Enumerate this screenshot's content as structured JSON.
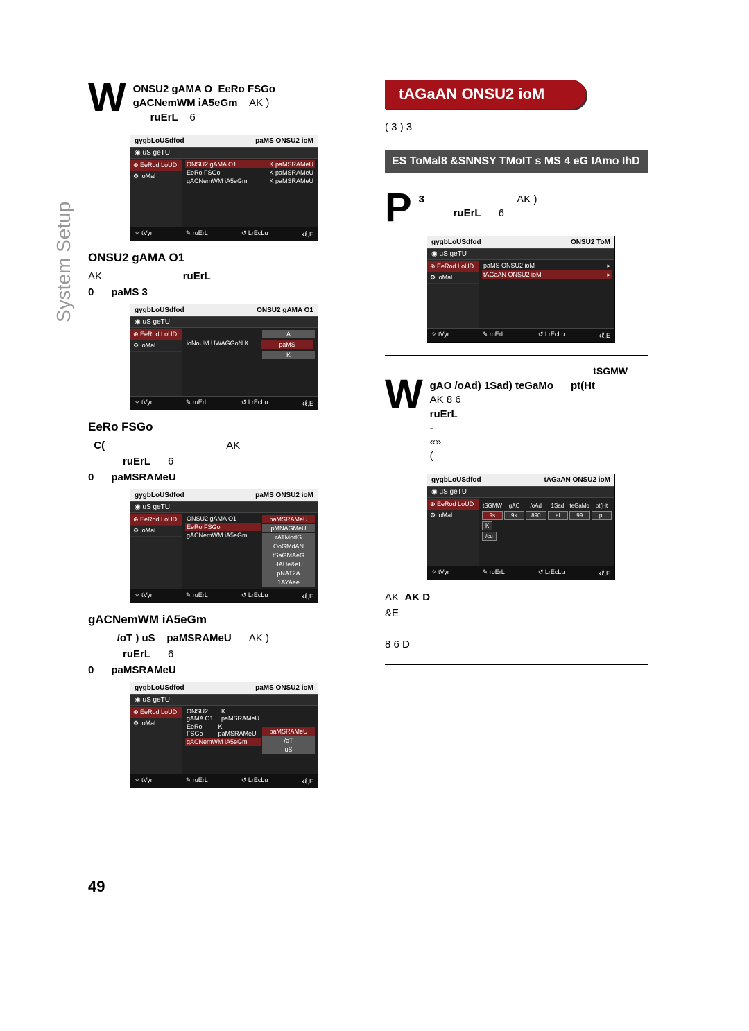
{
  "page": {
    "sideLabel": "System Setup",
    "pageNum": "49"
  },
  "leftCol": {
    "intro": {
      "bigLetter": "W",
      "line1a": "ONSU2 gAMA O",
      "line1b": "EeRo FSGo",
      "line2a": "gACNemWM iA5eGm",
      "line2b": "AK   )",
      "line3a": "ruErL",
      "line3b": "6"
    },
    "screenshotA": {
      "titleL": "gygbLoUSdfod",
      "titleR": "paMS ONSU2 ioM",
      "sub": "◉ uS geTU",
      "side1": "⊕ EeRod LoUD",
      "side2": "⚙ ioMal",
      "row1L": "ONSU2 gAMA O1",
      "row1R": "K paMSRAMeU",
      "row2L": "EeRo FSGo",
      "row2R": "K paMSRAMeU",
      "row3L": "gACNemWM iA5eGm",
      "row3R": "K paMSRAMeU",
      "f1": "✧ tVyr",
      "f2": "✎ ruErL",
      "f3": "↺ LrEcLu",
      "f4": "㎘,E"
    },
    "secA": {
      "head": "ONSU2 gAMA O1",
      "l1a": "AK",
      "l1b": "ruErL",
      "l2a": "0",
      "l2b": "paMS   3"
    },
    "screenshotB": {
      "titleL": "gygbLoUSdfod",
      "titleR": "ONSU2 gAMA O1",
      "sub": "◉ uS geTU",
      "side1": "⊕ EeRod LoUD",
      "side2": "⚙ ioMal",
      "mL": "ioNoUM UWAGGoN K",
      "mRa": "A",
      "mRb": "paMS",
      "mRc": "K",
      "f1": "✧ tVyr",
      "f2": "✎ ruErL",
      "f3": "↺ LrEcLu",
      "f4": "㎘,E"
    },
    "secB": {
      "head": "EeRo FSGo",
      "l1a": "C(",
      "l1b": "AK",
      "l2a": "ruErL",
      "l2b": "6",
      "l3a": "0",
      "l3b": "paMSRAMeU"
    },
    "screenshotC": {
      "titleL": "gygbLoUSdfod",
      "titleR": "paMS ONSU2 ioM",
      "sub": "◉ uS geTU",
      "side1": "⊕ EeRod LoUD",
      "side2": "⚙ ioMal",
      "row1L": "ONSU2 gAMA O1",
      "row2L": "EeRo FSGo",
      "row3L": "gACNemWM iA5eGm",
      "v1": "paMSRAMeU",
      "v2": "pMNAGMeU",
      "v3": "rATModG",
      "v4": "OoGMdAN",
      "v5": "tSaGMAeG",
      "v6": "HAUe&eU",
      "v7": "pNAT2A",
      "v8": "1AYAee",
      "f1": "✧ tVyr",
      "f2": "✎ ruErL",
      "f3": "↺ LrEcLu",
      "f4": "㎘,E"
    },
    "secC": {
      "head": "gACNemWM iA5eGm",
      "l1a": "/oT ) uS",
      "l1b": "paMSRAMeU",
      "l1c": "AK   )",
      "l2a": "ruErL",
      "l2b": "6",
      "l3a": "0",
      "l3b": "paMSRAMeU"
    },
    "screenshotD": {
      "titleL": "gygbLoUSdfod",
      "titleR": "paMS ONSU2 ioM",
      "sub": "◉ uS geTU",
      "side1": "⊕ EeRod LoUD",
      "side2": "⚙ ioMal",
      "row1L": "ONSU2 gAMA O1",
      "row1R": "K paMSRAMeU",
      "row2L": "EeRo FSGo",
      "row2R": "K paMSRAMeU",
      "row3L": "gACNemWM iA5eGm",
      "v1": "paMSRAMeU",
      "v2": "/oT",
      "v3": "uS",
      "f1": "✧ tVyr",
      "f2": "✎ ruErL",
      "f3": "↺ LrEcLu",
      "f4": "㎘,E"
    }
  },
  "rightCol": {
    "redTab": "tAGaAN ONSU2 ioM",
    "stepSeq": "(     3     )  3",
    "barHead": "ES ToMal8 &SNNSY TMoIT s MS 4 eG IAmo IhD",
    "introP": {
      "bigLetter": "P",
      "l1a": "3",
      "l1b": "AK     )",
      "l2a": "ruErL",
      "l2b": "6"
    },
    "screenshotE": {
      "titleL": "gygbLoUSdfod",
      "titleR": "ONSU2 ToM",
      "sub": "◉ uS geTU",
      "side1": "⊕ EeRod LoUD",
      "side2": "⚙ ioMal",
      "row1L": "paMS ONSU2 ioM",
      "row1R": "▸",
      "row2L": "tAGaAN ONSU2 ioM",
      "row2R": "▸",
      "f1": "✧ tVyr",
      "f2": "✎ ruErL",
      "f3": "↺ LrEcLu",
      "f4": "㎘,E"
    },
    "introW": {
      "bigLetter": "W",
      "l0b": "tSGMW",
      "l1a": "gAO /oAd) 1Sad) teGaMo",
      "l1b": "pt(Ht",
      "l2": "AK  8 6",
      "l3": "ruErL",
      "l4": "-",
      "l5": "    «»",
      "l6": "("
    },
    "screenshotF": {
      "titleL": "gygbLoUSdfod",
      "titleR": "tAGaAN ONSU2 ioM",
      "sub": "◉ uS geTU",
      "side1": "⊕ EeRod LoUD",
      "side2": "⚙ ioMal",
      "th1": "tSGMW",
      "th2": "gAC",
      "th3": "/oAd",
      "th4": "1Sad",
      "th5": "teGaMo",
      "th6": "pt(Ht",
      "td1": "9s",
      "td2": "9s",
      "td3": "890",
      "td4": "al",
      "td5": "99",
      "td6": "pt",
      "td7": "K",
      "td8": "/cu",
      "f1": "✧ tVyr",
      "f2": "✎ ruErL",
      "f3": "↺ LrEcLu",
      "f4": "㎘,E"
    },
    "afterF": {
      "l1": "AK   D",
      "l2": "        &E",
      "l3": "8 6  D"
    }
  }
}
